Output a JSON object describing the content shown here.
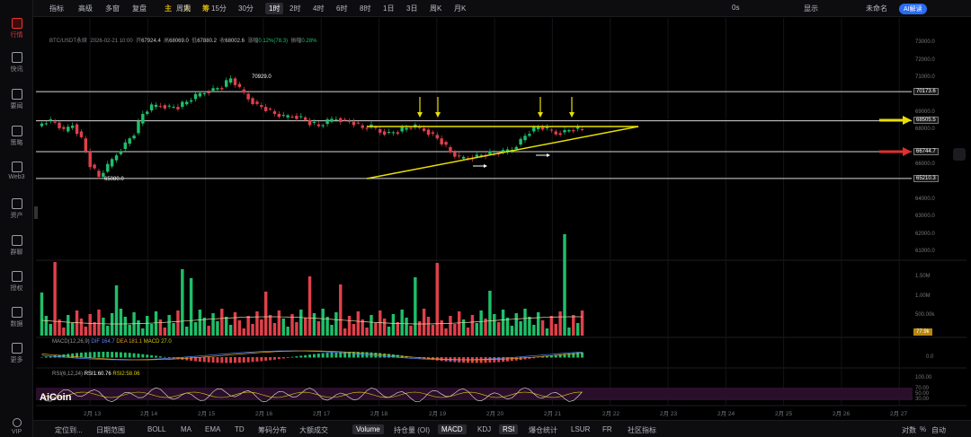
{
  "sidebar": {
    "items": [
      {
        "label": "行情",
        "icon": "chart-icon"
      },
      {
        "label": "快讯",
        "icon": "news-icon"
      },
      {
        "label": "要闻",
        "icon": "article-icon"
      },
      {
        "label": "策略",
        "icon": "strategy-icon"
      },
      {
        "label": "Web3",
        "icon": "web3-icon"
      },
      {
        "label": "资产",
        "icon": "wallet-icon"
      },
      {
        "label": "群聊",
        "icon": "chat-icon"
      },
      {
        "label": "授权",
        "icon": "auth-icon"
      },
      {
        "label": "数据",
        "icon": "data-icon"
      },
      {
        "label": "更多",
        "icon": "more-icon"
      },
      {
        "label": "VIP",
        "icon": "vip-icon"
      }
    ]
  },
  "toolbar": {
    "indicators": "指标",
    "advanced": "高级",
    "multi": "多窗",
    "replay": "复盘",
    "main": "主",
    "big": "大",
    "chips": "筹",
    "period_label": "周期",
    "periods": [
      "15分",
      "30分",
      "1时",
      "2时",
      "4时",
      "6时",
      "8时",
      "1日",
      "3日",
      "周K",
      "月K"
    ],
    "selected_period": "1时",
    "time": "0s",
    "display": "显示",
    "unnamed": "未命名",
    "ai": "AI解读"
  },
  "info": {
    "pair": "BTC/USDT永续",
    "datetime": "2026-02-21 10:00",
    "open_l": "开",
    "open": "67924.4",
    "high_l": "高",
    "high": "68069.0",
    "low_l": "低",
    "low": "67880.2",
    "close_l": "收",
    "close": "68002.6",
    "chg_l": "涨幅",
    "chg": "0.12%(78.3)",
    "amp_l": "振幅",
    "amp": "0.28%"
  },
  "price_axis": [
    "73000.0",
    "72000.0",
    "71000.0",
    "70000.0",
    "69000.0",
    "68000.0",
    "67000.0",
    "66000.0",
    "65000.0",
    "64000.0",
    "63000.0",
    "62000.0",
    "61000.0"
  ],
  "levels": {
    "l1": "70173.6",
    "l2": "68505.5",
    "l3": "66744.7",
    "l4": "65210.3"
  },
  "marks": {
    "high": "70929.0",
    "low": "65080.0"
  },
  "volume_axis": [
    "1.50M",
    "1.00M",
    "500.00k"
  ],
  "volume_tag": "77.9k",
  "macd": {
    "label": "MACD(12,26,9)",
    "dif": "DIF 164.7",
    "dea": "DEA 181.1",
    "macd": "MACD 27.0"
  },
  "macd_axis": "0.0",
  "rsi": {
    "label": "RSI(6,12,24)",
    "rsi1": "RSI1:60.76",
    "rsi2": "RSI2:58.06"
  },
  "rsi_axis": [
    "100.00",
    "70.00",
    "50.00",
    "30.00"
  ],
  "brand": "AiCoin",
  "dates": [
    "2月 13",
    "2月 14",
    "2月 15",
    "2月 16",
    "2月 17",
    "2月 18",
    "2月 19",
    "2月 20",
    "2月 21",
    "2月 22",
    "2月 23",
    "2月 24",
    "2月 25",
    "2月 26",
    "2月 27"
  ],
  "bottom": {
    "locate": "定位到...",
    "range": "日期范围",
    "tabs": [
      "BOLL",
      "MA",
      "EMA",
      "TD",
      "筹码分布",
      "大额成交",
      "Volume",
      "持仓量 (OI)",
      "MACD",
      "KDJ",
      "RSI",
      "爆仓统计",
      "LSUR",
      "FR",
      "社区指标"
    ],
    "selected": [
      "Volume",
      "MACD",
      "RSI"
    ],
    "log": "对数",
    "pct": "%",
    "auto": "自动"
  },
  "colors": {
    "up": "#1fbf6a",
    "down": "#e0404a",
    "accent": "#2b6cf0",
    "trend": "#e8e000"
  },
  "chart_data": {
    "type": "candlestick",
    "pair": "BTC/USDT永续",
    "interval": "1时",
    "close": [
      68200,
      68500,
      68400,
      67900,
      68300,
      67500,
      66000,
      65300,
      65900,
      66600,
      67200,
      67800,
      68900,
      69300,
      69400,
      69300,
      69300,
      69600,
      69900,
      70150,
      70300,
      70450,
      70929,
      70300,
      69800,
      69400,
      69200,
      68900,
      68700,
      68800,
      68700,
      68400,
      68200,
      68450,
      68650,
      68500,
      68400,
      68100,
      68150,
      67900,
      67800,
      67900,
      68100,
      68150,
      68000,
      67700,
      67300,
      66700,
      66350,
      66400,
      66500,
      66600,
      66650,
      66700,
      66900,
      67400,
      67900,
      68150,
      68000,
      67800,
      67900,
      68050,
      68003
    ],
    "volume_peak_k": 1520,
    "support_resistance": [
      70173.6,
      68505.5,
      66744.7,
      65210.3
    ],
    "ylim": [
      61000,
      73500
    ]
  }
}
